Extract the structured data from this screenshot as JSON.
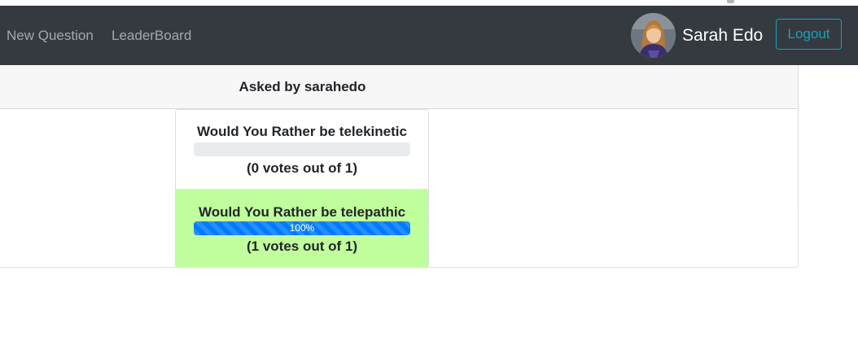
{
  "navbar": {
    "links": [
      "New Question",
      "LeaderBoard"
    ],
    "user_name": "Sarah Edo",
    "avatar_icon": "user-avatar",
    "logout_label": "Logout",
    "colors": {
      "background": "#343a40",
      "logout_accent": "#17a2b8"
    }
  },
  "question": {
    "asked_by": "Asked by sarahedo",
    "options": [
      {
        "text": "Would You Rather be telekinetic",
        "percent": 0,
        "progress_label": "",
        "votes_text": "(0 votes out of 1)",
        "selected": false
      },
      {
        "text": "Would You Rather be telepathic",
        "percent": 100,
        "progress_label": "100%",
        "votes_text": "(1 votes out of 1)",
        "selected": true
      }
    ],
    "colors": {
      "selected_background": "#c1fe9e",
      "progress": "#007bff"
    }
  }
}
